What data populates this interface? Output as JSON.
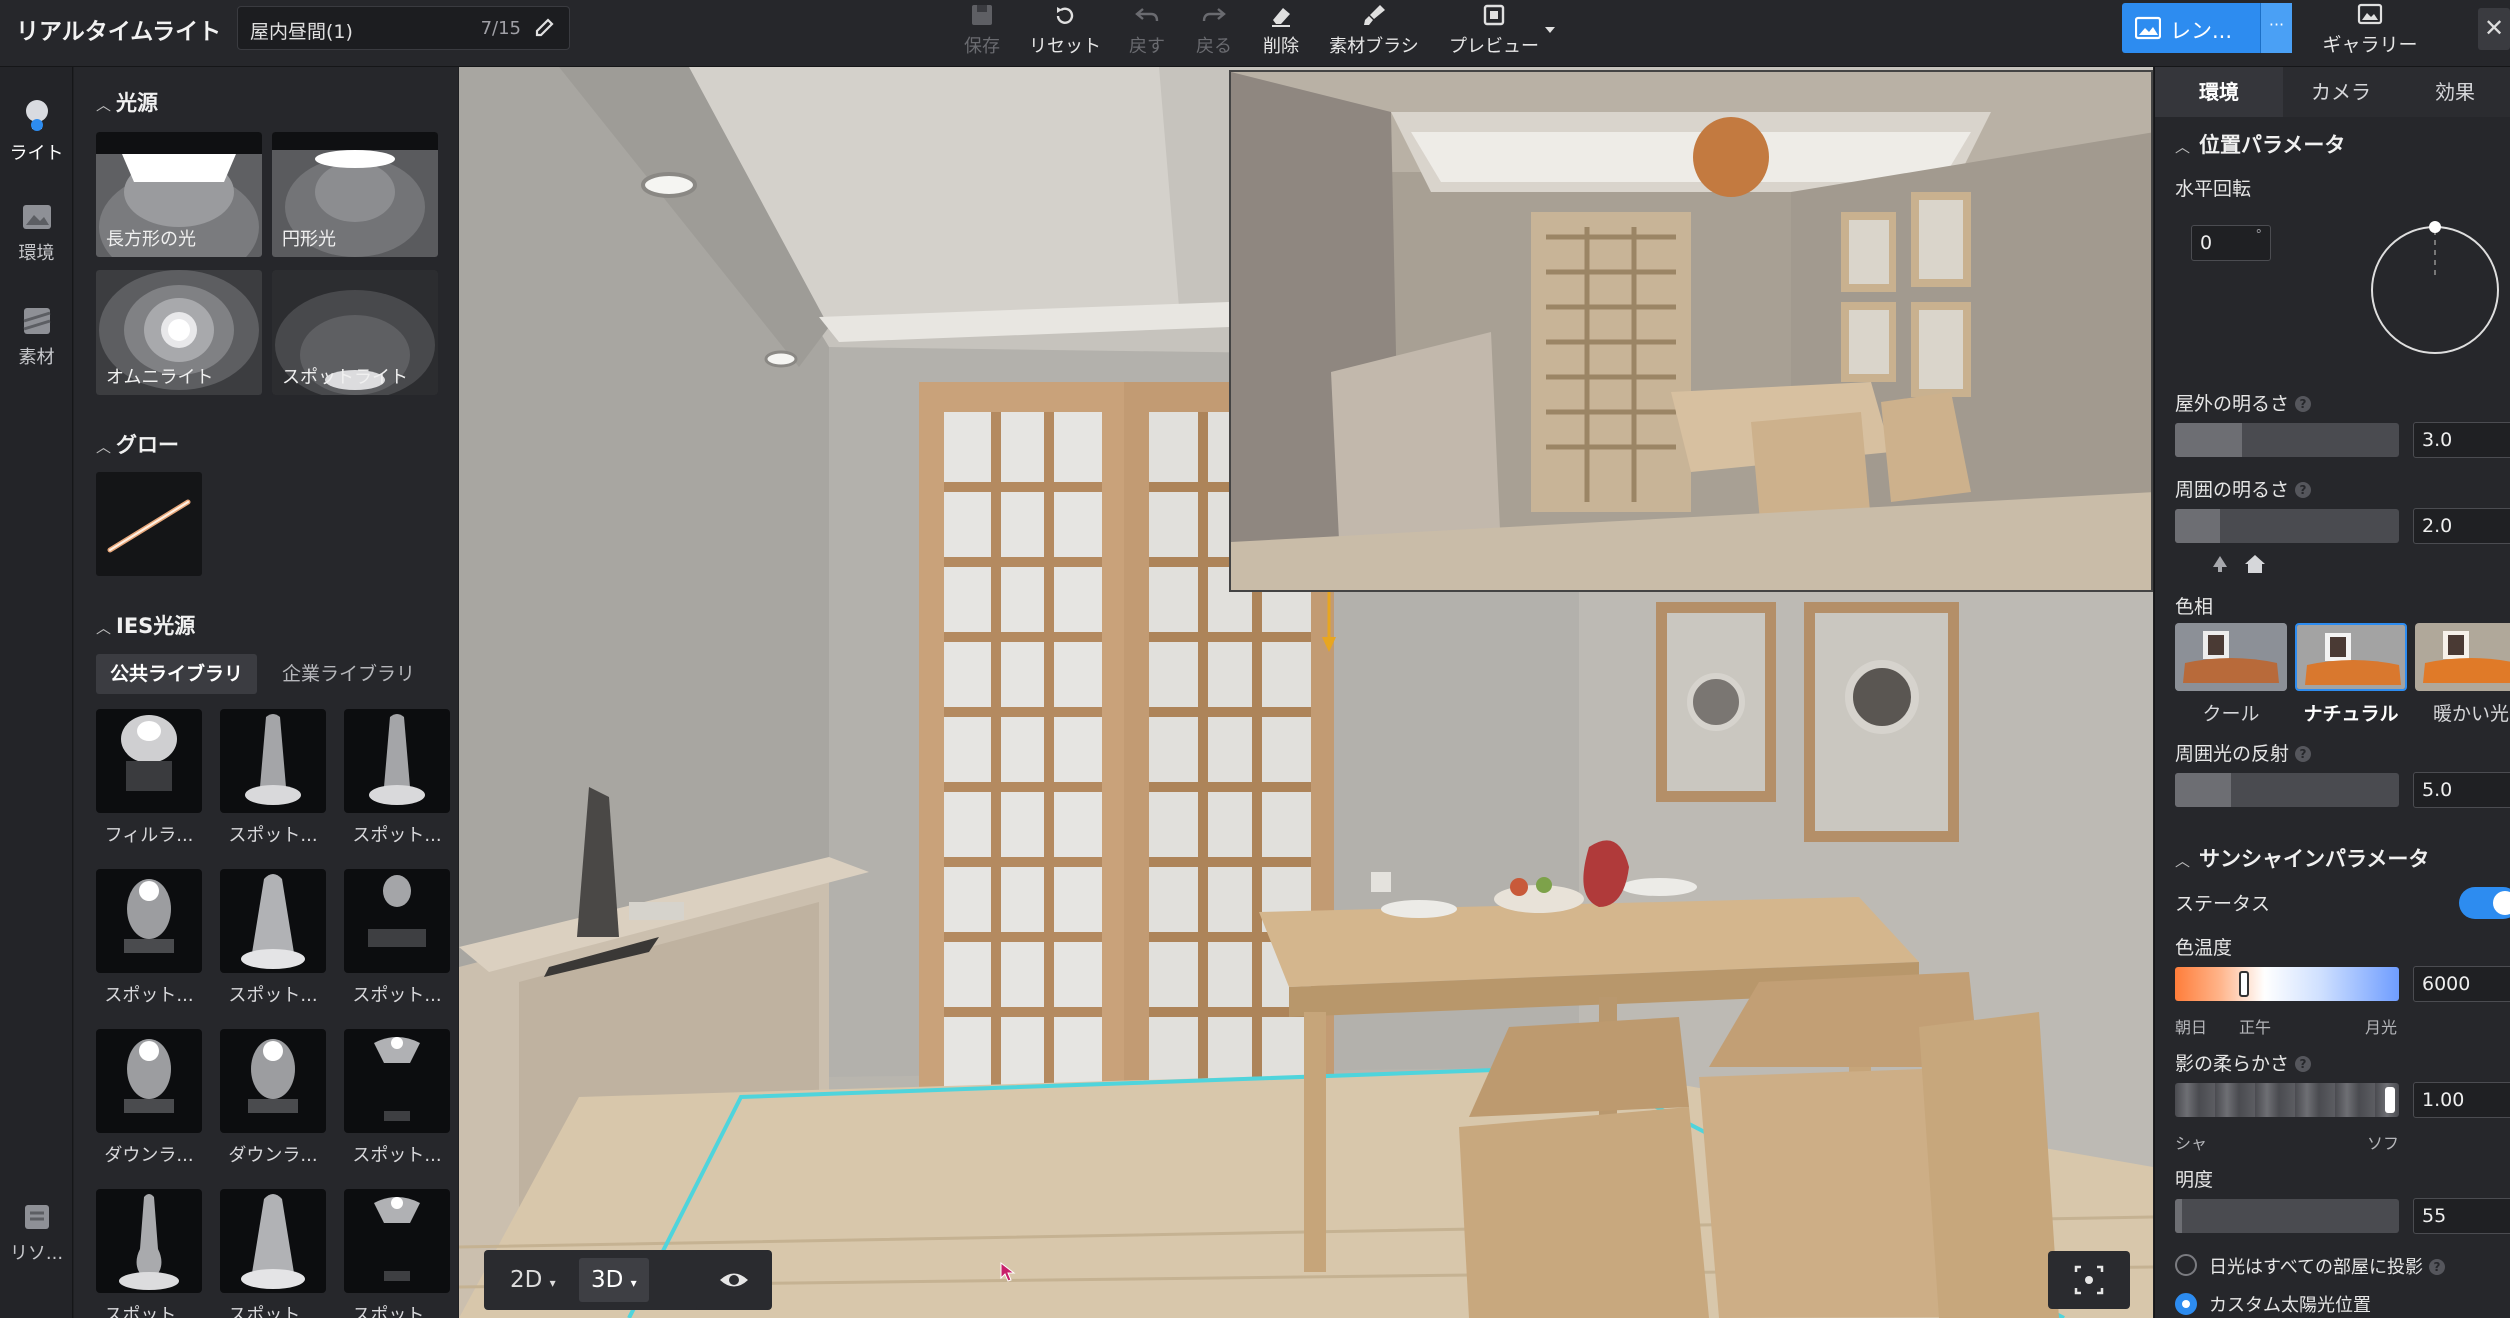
{
  "app": {
    "title": "リアルタイムライト"
  },
  "scene": {
    "name": "屋内昼間(1)",
    "count": "7/15"
  },
  "toolbar": {
    "save": "保存",
    "reset": "リセット",
    "undo": "戻す",
    "redo": "戻る",
    "delete": "削除",
    "brush": "素材ブラシ",
    "preview": "プレビュー",
    "render": "レン...",
    "render_more": "···",
    "gallery": "ギャラリー"
  },
  "rail": {
    "light": "ライト",
    "environment": "環境",
    "material": "素材",
    "resource": "リソ..."
  },
  "left_panel": {
    "light_source": {
      "title": "光源",
      "items": [
        "長方形の光",
        "円形光",
        "オムニライト",
        "スポットライト"
      ]
    },
    "glow": {
      "title": "グロー"
    },
    "ies": {
      "title": "IES光源",
      "tabs": [
        "公共ライブラリ",
        "企業ライブラリ"
      ],
      "items": [
        "フィルラ...",
        "スポット...",
        "スポット...",
        "スポット...",
        "スポット...",
        "スポット...",
        "ダウンラ...",
        "ダウンラ...",
        "スポット...",
        "スポット...",
        "スポット...",
        "スポット..."
      ]
    }
  },
  "viewport": {
    "view_2d": "2D",
    "view_3d": "3D"
  },
  "right_panel": {
    "tabs": [
      "環境",
      "カメラ",
      "効果"
    ],
    "position": {
      "title": "位置パラメータ",
      "horizontal_rotation_label": "水平回転",
      "horizontal_rotation_value": "0",
      "degree_unit": "°"
    },
    "outdoor_brightness": {
      "label": "屋外の明るさ",
      "value": "3.0",
      "level": 0.3
    },
    "ambient_brightness": {
      "label": "周囲の明るさ",
      "value": "2.0",
      "level": 0.2
    },
    "hue": {
      "label": "色相",
      "options": [
        "クール",
        "ナチュラル",
        "暖かい光"
      ],
      "selected": "ナチュラル"
    },
    "ambient_reflection": {
      "label": "周囲光の反射",
      "value": "5.0",
      "level": 0.25
    },
    "sunshine": {
      "title": "サンシャインパラメータ",
      "status_label": "ステータス",
      "status_on": true,
      "color_temp_label": "色温度",
      "color_temp_value": "6000",
      "color_temp_marks": [
        "朝日",
        "正午",
        "月光"
      ],
      "shadow_softness_label": "影の柔らかさ",
      "shadow_softness_value": "1.00",
      "shadow_marks": [
        "シャ",
        "ソフ"
      ],
      "brightness_label": "明度",
      "brightness_value": "55",
      "brightness_level": 0.03,
      "option_all_rooms": "日光はすべての部屋に投影",
      "option_custom_sun": "カスタム太陽光位置"
    }
  }
}
